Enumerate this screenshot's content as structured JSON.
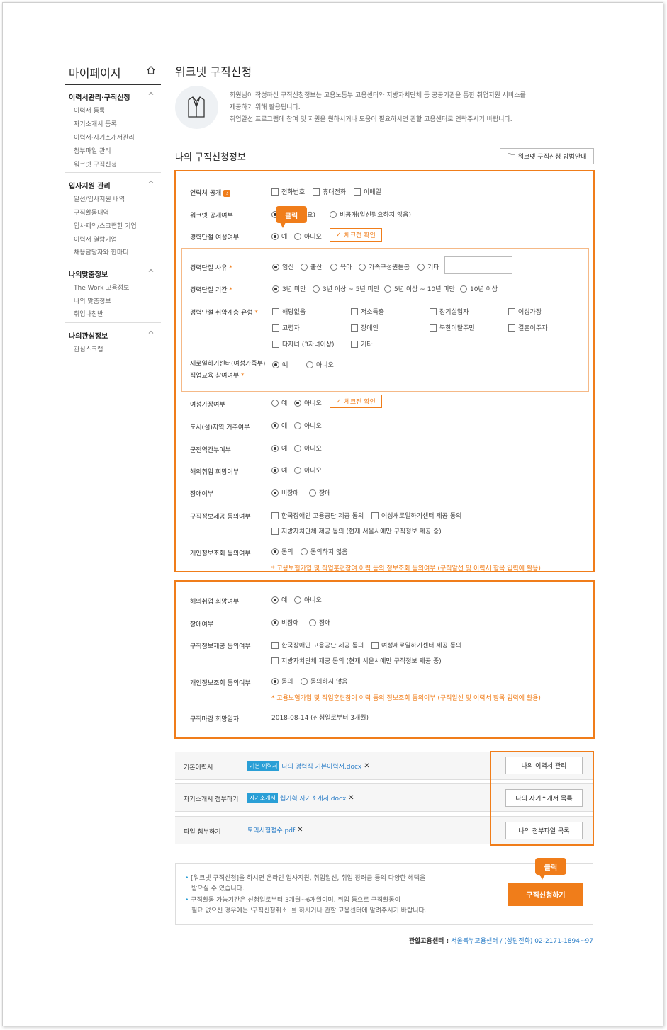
{
  "sidebar": {
    "title": "마이페이지",
    "groups": [
      {
        "title": "이력서관리·구직신청",
        "items": [
          "이력서 등록",
          "자기소개서 등록",
          "이력서·자기소개서관리",
          "첨부파일 관리",
          "워크넷 구직신청"
        ]
      },
      {
        "title": "입사지원 관리",
        "items": [
          "알선/입사지원 내역",
          "구직활동내역",
          "입사제의/스크랩한 기업",
          "이력서 열람기업",
          "채용담당자와 한마디"
        ]
      },
      {
        "title": "나의맞춤정보",
        "items": [
          "The Work 고용정보",
          "나의 맞춤정보",
          "취업나침반"
        ]
      },
      {
        "title": "나의관심정보",
        "items": [
          "관심스크랩"
        ]
      }
    ]
  },
  "page": {
    "title": "워크넷 구직신청",
    "intro": [
      "회원님이 작성하신 구직신청정보는 고용노동부 고용센터와 지방자치단체 등 공공기관을 통한 취업지원 서비스를",
      "제공하기 위해 활용됩니다.",
      "취업알선 프로그램에 참여 및 지원을 원하시거나 도움이 필요하시면 관할 고용센터로 연락주시기 바랍니다."
    ],
    "section_title": "나의 구직신청정보",
    "guide_button": "워크넷 구직신청 방법안내"
  },
  "bubble_label": "클릭",
  "check_button": "체크전 확인",
  "form1": {
    "contact": {
      "label": "연락처 공개",
      "q": "?",
      "options": [
        "전화번호",
        "휴대전화",
        "이메일"
      ]
    },
    "worknet_public": {
      "label": "워크넷 공개여부",
      "options": [
        "공개(알선필요)",
        "비공개(알선필요하지 않음)"
      ],
      "partial": "필요)"
    },
    "career_break": {
      "label": "경력단절 여성여부",
      "options": [
        "예",
        "아니오"
      ]
    },
    "reason": {
      "label": "경력단절 사유",
      "req": "*",
      "options": [
        "임신",
        "출산",
        "육아",
        "가족구성원돌봄",
        "기타"
      ]
    },
    "period": {
      "label": "경력단절 기간",
      "req": "*",
      "options": [
        "3년 미만",
        "3년 이상 ~ 5년 미만",
        "5년 이상 ~ 10년 미만",
        "10년 이상"
      ]
    },
    "vulnerable": {
      "label": "경력단절 취약계층 유형",
      "req": "*",
      "options": [
        "해당없음",
        "저소득층",
        "장기실업자",
        "여성가장",
        "고령자",
        "장애인",
        "북한이탈주민",
        "결혼이주자",
        "다자녀 (3자녀이상)",
        "기타"
      ]
    },
    "center": {
      "label1": "새로일하기센터(여성가족부)",
      "label2": "직업교육 참여여부",
      "req": "*",
      "options": [
        "예",
        "아니오"
      ]
    },
    "female_head": {
      "label": "여성가장여부",
      "options": [
        "예",
        "아니오"
      ]
    },
    "island": {
      "label": "도서(섬)지역 거주여부",
      "options": [
        "예",
        "아니오"
      ]
    },
    "military": {
      "label": "군전역간부여부",
      "options": [
        "예",
        "아니오"
      ]
    },
    "overseas": {
      "label": "해외취업 희망여부",
      "options": [
        "예",
        "아니오"
      ]
    },
    "disability": {
      "label": "장애여부",
      "options": [
        "비장애",
        "장애"
      ]
    },
    "consent": {
      "label": "구직정보제공 동의여부",
      "options": [
        "한국장애인 고용공단 제공 동의",
        "여성새로일하기센터 제공 동의",
        "지방자치단체 제공 동의 (현재 서울시에만 구직정보 제공 중)"
      ]
    },
    "privacy": {
      "label": "개인정보조회 동의여부",
      "options": [
        "동의",
        "동의하지 않음"
      ]
    },
    "note": "* 고용보험가입 및 직업훈련참여 이력 등의 정보조회 동의여부 (구직알선 및 이력서 항목 입력에 활용)"
  },
  "form2": {
    "overseas": {
      "label": "해외취업 희망여부",
      "options": [
        "예",
        "아니오"
      ]
    },
    "disability": {
      "label": "장애여부",
      "options": [
        "비장애",
        "장애"
      ]
    },
    "consent": {
      "label": "구직정보제공 동의여부",
      "options": [
        "한국장애인 고용공단 제공 동의",
        "여성새로일하기센터 제공 동의",
        "지방자치단체 제공 동의 (현재 서울시에만 구직정보 제공 중)"
      ]
    },
    "privacy": {
      "label": "개인정보조회 동의여부",
      "options": [
        "동의",
        "동의하지 않음"
      ]
    },
    "note": "* 고용보험가입 및 직업훈련참여 이력 등의 정보조회 동의여부 (구직알선 및 이력서 항목 입력에 활용)",
    "deadline": {
      "label": "구직마감 희망일자",
      "value": "2018-08-14 (신청일로부터 3개월)"
    }
  },
  "files": [
    {
      "label": "기본이력서",
      "badge": "기본 이력서",
      "file": "나의 경력직 기본이력서.docx",
      "button": "나의 이력서 관리"
    },
    {
      "label": "자기소개서 첨부하기",
      "badge": "자기소개서",
      "file": "웹기획 자기소개서.docx",
      "button": "나의 자기소개서 목록"
    },
    {
      "label": "파일 첨부하기",
      "badge": "",
      "file": "토익시험점수.pdf",
      "button": "나의 첨부파일 목록"
    }
  ],
  "bottom": {
    "notes": [
      [
        "[워크넷 구직신청]을 하시면 온라인 입사지원, 취업알선, 취업 장려금 등의 다양한 혜택을",
        "받으실 수 있습니다."
      ],
      [
        "구직활동 가능기간은 신청일로부터 3개월~6개월이며, 취업 등으로 구직활동이",
        "필요 없으신 경우에는 '구직신청취소' 를 하시거나 관할 고용센터에 알려주시기 바랍니다."
      ]
    ],
    "submit": "구직신청하기",
    "office_label": "관할고용센터 : ",
    "office_value": "서울북부고용센터 / (상담전화) 02-2171-1894~97"
  }
}
